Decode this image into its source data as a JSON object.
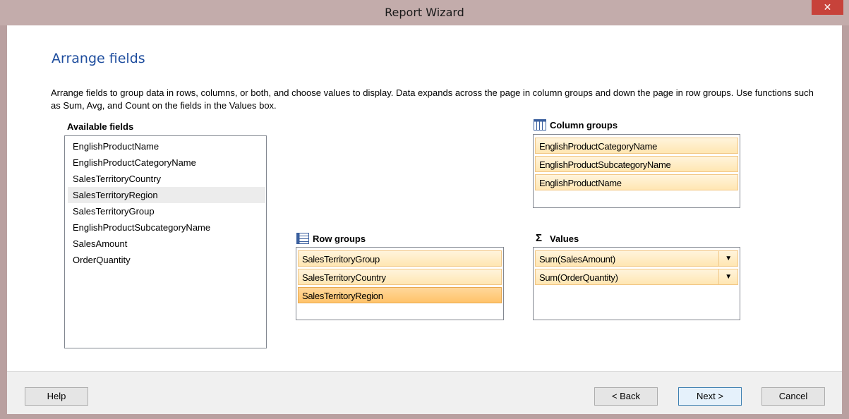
{
  "window": {
    "title": "Report Wizard",
    "close_label": "✕"
  },
  "page": {
    "heading": "Arrange fields",
    "description": "Arrange fields to group data in rows, columns, or both, and choose values to display. Data expands across the page in column groups and down the page in row groups.  Use functions such as Sum, Avg, and Count on the fields in the Values box."
  },
  "available": {
    "label": "Available fields",
    "items": [
      "EnglishProductName",
      "EnglishProductCategoryName",
      "SalesTerritoryCountry",
      "SalesTerritoryRegion",
      "SalesTerritoryGroup",
      "EnglishProductSubcategoryName",
      "SalesAmount",
      "OrderQuantity"
    ],
    "selected": "SalesTerritoryRegion"
  },
  "column_groups": {
    "label": "Column groups",
    "items": [
      "EnglishProductCategoryName",
      "EnglishProductSubcategoryName",
      "EnglishProductName"
    ]
  },
  "row_groups": {
    "label": "Row groups",
    "items": [
      "SalesTerritoryGroup",
      "SalesTerritoryCountry",
      "SalesTerritoryRegion"
    ],
    "selected": "SalesTerritoryRegion"
  },
  "values": {
    "label": "Values",
    "symbol": "Σ",
    "items": [
      "Sum(SalesAmount)",
      "Sum(OrderQuantity)"
    ],
    "dropdown_glyph": "▼"
  },
  "footer": {
    "help": "Help",
    "back": "< Back",
    "next": "Next >",
    "cancel": "Cancel"
  }
}
